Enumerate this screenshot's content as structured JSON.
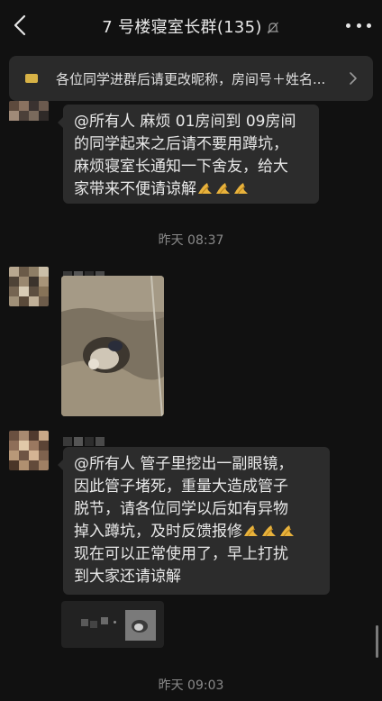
{
  "header": {
    "back_icon": "chevron-left-icon",
    "title": "7 号楼寝室长群(135)",
    "mute_icon": "bell-muted-icon",
    "more_icon": "ellipsis-icon"
  },
  "pinned": {
    "icon": "pinned-notice-icon",
    "text": "各位同学进群后请更改昵称，房间号＋姓名...",
    "chevron_icon": "chevron-right-icon"
  },
  "messages": [
    {
      "type": "text",
      "lines": [
        "@所有人 麻烦 01房间到 09房间",
        "的同学起来之后请不要用蹲坑，",
        "麻烦寝室长通知一下舍友，给大",
        "家带来不便请谅解"
      ],
      "emoji": "pray-hands-emoji",
      "emoji_count": 3
    },
    {
      "type": "time",
      "text": "昨天 08:37"
    },
    {
      "type": "image",
      "description_icon": "photo-icon"
    },
    {
      "type": "text",
      "lines": [
        "@所有人 管子里挖出一副眼镜，",
        "因此管子堵死，重量大造成管子",
        "脱节，请各位同学以后如有异物",
        "掉入蹲坑，及时反馈报修",
        "现在可以正常使用了，早上打扰",
        "到大家还请谅解"
      ],
      "emoji": "pray-hands-emoji",
      "emoji_count": 3
    },
    {
      "type": "time",
      "text": "昨天 09:03"
    }
  ],
  "colors": {
    "background": "#111111",
    "bubble": "#2c2c2c",
    "pin_bar": "#2a2a2a",
    "pin_icon": "#d7b246",
    "timestamp": "#8a8a8a",
    "text": "#e8e8e8"
  }
}
